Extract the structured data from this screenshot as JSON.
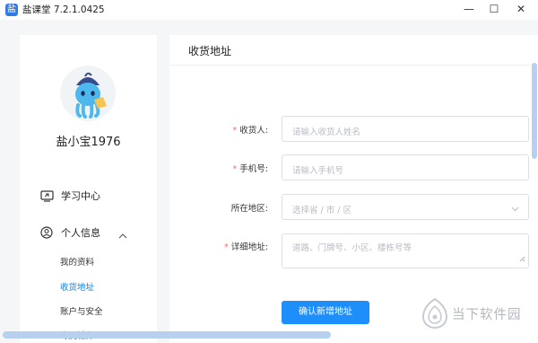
{
  "window": {
    "app_icon": "盐",
    "title": "盐课堂 7.2.1.0425",
    "minimize_glyph": "—",
    "maximize_glyph": "☐",
    "close_glyph": "✕"
  },
  "sidebar": {
    "username": "盐小宝1976",
    "nav": {
      "study_center": "学习中心",
      "personal_info": "个人信息"
    },
    "sub_items": [
      "我的资料",
      "收货地址",
      "账户与安全",
      "专属辅师"
    ],
    "active_sub_item": "收货地址"
  },
  "main": {
    "title": "收货地址",
    "form": {
      "required_mark": "*",
      "recipient": {
        "label": "收货人:",
        "placeholder": "请输入收货人姓名",
        "required": true
      },
      "phone": {
        "label": "手机号:",
        "placeholder": "请输入手机号",
        "required": true
      },
      "region": {
        "label": "所在地区:",
        "placeholder": "选择省 / 市 / 区",
        "required": false
      },
      "detail": {
        "label": "详细地址:",
        "placeholder": "道路、门牌号、小区、楼栋号等",
        "required": true
      },
      "submit_label": "确认新增地址"
    }
  },
  "watermark": {
    "text": "当下软件园"
  },
  "colors": {
    "accent": "#1e8ffa",
    "active_link": "#1a7de5",
    "required": "#f56c6c"
  }
}
